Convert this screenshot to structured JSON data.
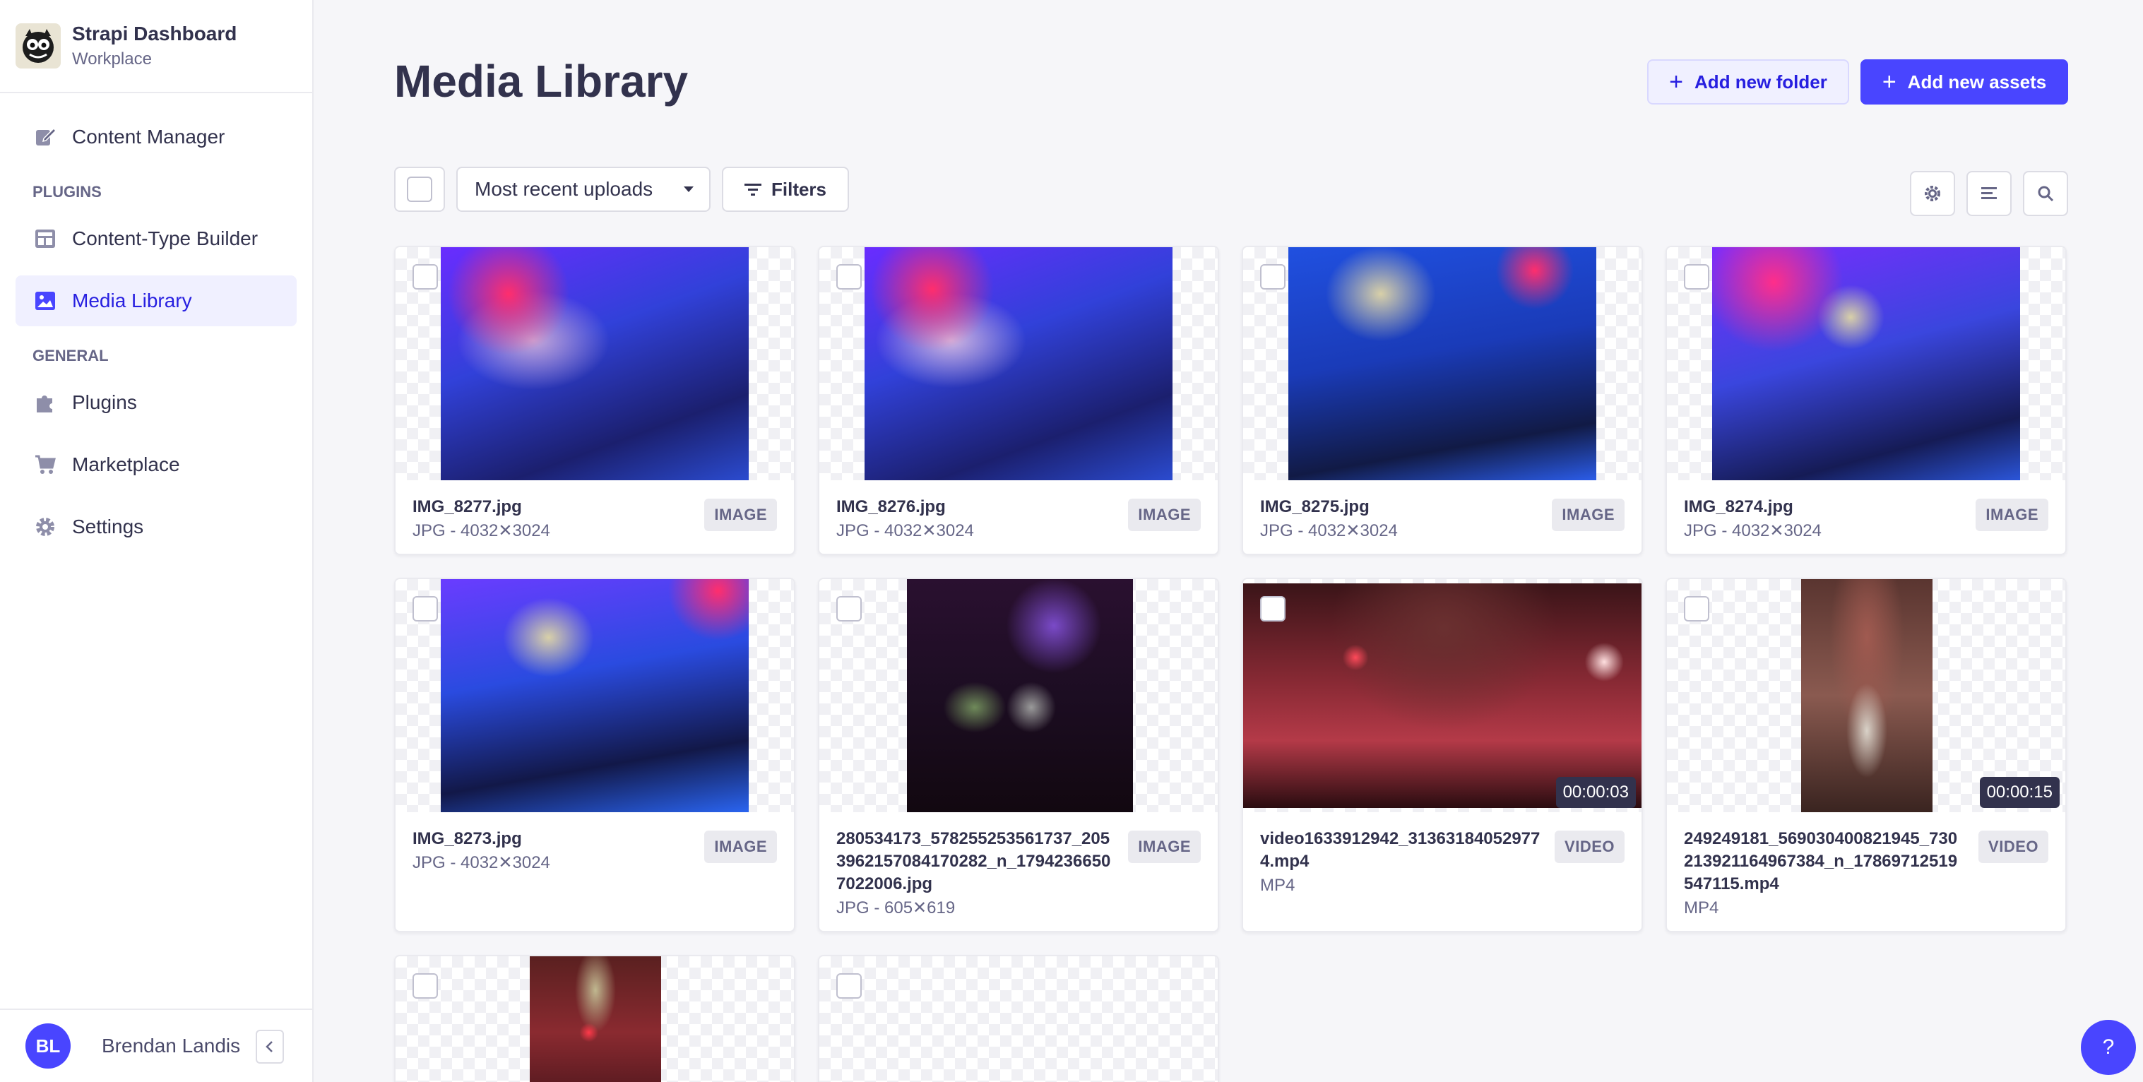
{
  "app": {
    "title": "Strapi Dashboard",
    "workspace": "Workplace"
  },
  "sidebar": {
    "items_top": [
      {
        "label": "Content Manager",
        "icon": "pencil-icon"
      }
    ],
    "section_plugins": "PLUGINS",
    "items_plugins": [
      {
        "label": "Content-Type Builder",
        "icon": "layout-icon"
      },
      {
        "label": "Media Library",
        "icon": "image-icon",
        "active": true
      }
    ],
    "section_general": "GENERAL",
    "items_general": [
      {
        "label": "Plugins",
        "icon": "puzzle-icon"
      },
      {
        "label": "Marketplace",
        "icon": "cart-icon"
      },
      {
        "label": "Settings",
        "icon": "gear-icon"
      }
    ],
    "user": {
      "initials": "BL",
      "name": "Brendan Landis"
    }
  },
  "header": {
    "title": "Media Library",
    "add_folder_label": "Add new folder",
    "add_assets_label": "Add new assets"
  },
  "toolbar": {
    "sort_value": "Most recent uploads",
    "filters_label": "Filters"
  },
  "assets": [
    {
      "name": "IMG_8277.jpg",
      "meta": "JPG - 4032✕3024",
      "type": "IMAGE"
    },
    {
      "name": "IMG_8276.jpg",
      "meta": "JPG - 4032✕3024",
      "type": "IMAGE"
    },
    {
      "name": "IMG_8275.jpg",
      "meta": "JPG - 4032✕3024",
      "type": "IMAGE"
    },
    {
      "name": "IMG_8274.jpg",
      "meta": "JPG - 4032✕3024",
      "type": "IMAGE"
    },
    {
      "name": "IMG_8273.jpg",
      "meta": "JPG - 4032✕3024",
      "type": "IMAGE"
    },
    {
      "name": "280534173_578255253561737_2053962157084170282_n_17942366507022006.jpg",
      "meta": "JPG - 605✕619",
      "type": "IMAGE"
    },
    {
      "name": "video1633912942_313631840529774.mp4",
      "meta": "MP4",
      "type": "VIDEO",
      "duration": "00:00:03"
    },
    {
      "name": "249249181_569030400821945_730213921164967384_n_17869712519547115.mp4",
      "meta": "MP4",
      "type": "VIDEO",
      "duration": "00:00:15"
    }
  ],
  "help": {
    "label": "?"
  },
  "colors": {
    "accent": "#4945ff",
    "accent_light": "#f0f0ff",
    "text": "#32324d",
    "muted": "#666687"
  }
}
